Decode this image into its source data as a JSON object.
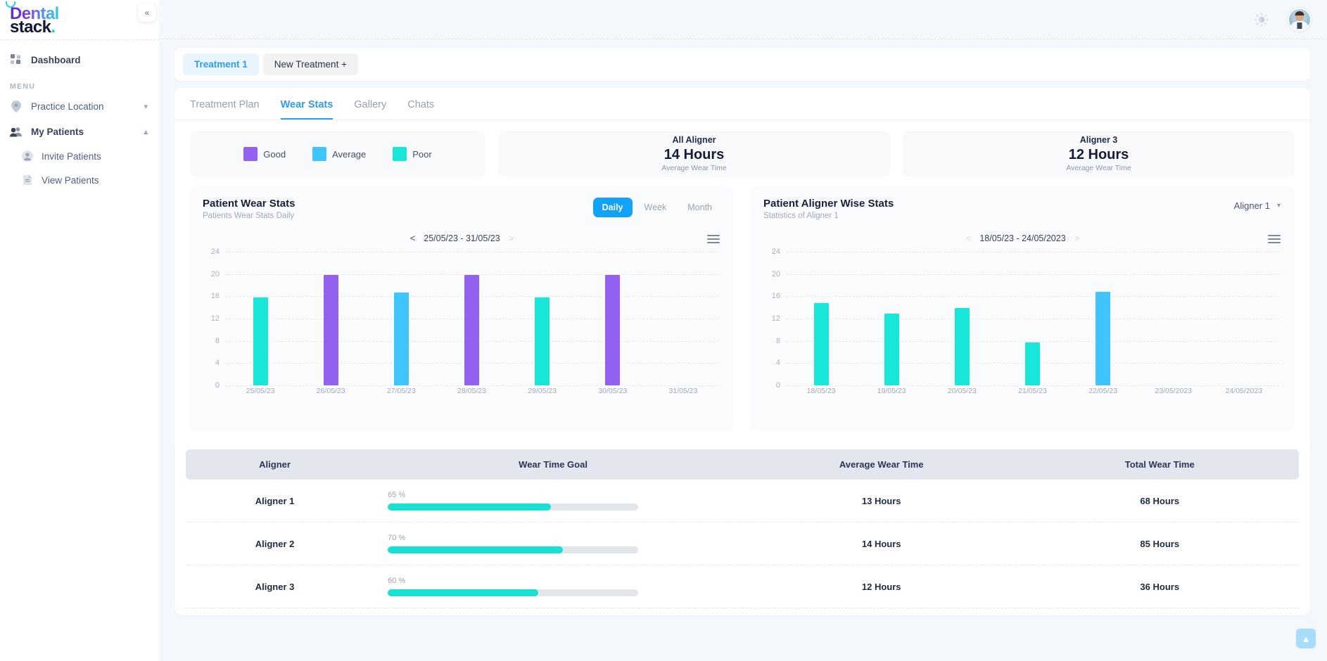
{
  "brand": {
    "name_top": "Dental",
    "name_bottom": "stack",
    "dot": "."
  },
  "sidebar": {
    "collapse_icon": "chevron-double-left-icon",
    "dashboard": {
      "label": "Dashboard",
      "icon": "grid-icon"
    },
    "menu_heading": "MENU",
    "items": [
      {
        "label": "Practice Location",
        "icon": "location-pin-icon",
        "caret": "chevron-down-icon",
        "expanded": false
      },
      {
        "label": "My Patients",
        "icon": "people-icon",
        "caret": "chevron-up-icon",
        "expanded": true
      }
    ],
    "sub_items": [
      {
        "label": "Invite Patients",
        "icon": "user-circle-icon"
      },
      {
        "label": "View Patients",
        "icon": "document-icon"
      }
    ]
  },
  "topbar": {
    "theme_icon": "sun-moon-toggle-icon",
    "avatar": "doctor-avatar"
  },
  "treatments": {
    "tabs": [
      {
        "label": "Treatment 1",
        "active": true
      },
      {
        "label": "New Treatment +",
        "active": false
      }
    ]
  },
  "subtabs": [
    {
      "label": "Treatment Plan",
      "active": false
    },
    {
      "label": "Wear Stats",
      "active": true
    },
    {
      "label": "Gallery",
      "active": false
    },
    {
      "label": "Chats",
      "active": false
    }
  ],
  "legend": [
    {
      "label": "Good",
      "color": "#9361f0"
    },
    {
      "label": "Average",
      "color": "#3fc4fb"
    },
    {
      "label": "Poor",
      "color": "#18e6d8"
    }
  ],
  "stat_cards": [
    {
      "title": "All Aligner",
      "value": "14 Hours",
      "subtitle": "Average Wear Time"
    },
    {
      "title": "Aligner 3",
      "value": "12 Hours",
      "subtitle": "Average Wear Time"
    }
  ],
  "left_chart_panel": {
    "title": "Patient Wear Stats",
    "subtitle": "Patients Wear Stats Daily",
    "segments": [
      {
        "label": "Daily",
        "active": true
      },
      {
        "label": "Week",
        "active": false
      },
      {
        "label": "Month",
        "active": false
      }
    ],
    "range": "25/05/23 - 31/05/23",
    "prev_arrow": "<",
    "next_arrow": ">",
    "menu_icon": "hamburger-menu-icon"
  },
  "right_chart_panel": {
    "title": "Patient Aligner Wise Stats",
    "subtitle": "Statistics of Aligner 1",
    "selected_aligner": "Aligner 1",
    "select_caret": "chevron-down-icon",
    "range": "18/05/23 - 24/05/2023",
    "prev_arrow": "<",
    "next_arrow": ">",
    "menu_icon": "hamburger-menu-icon"
  },
  "chart_data": [
    {
      "type": "bar",
      "id": "patient-wear-stats",
      "title": "Patient Wear Stats",
      "subtitle": "Patients Wear Stats Daily",
      "range_label": "25/05/23 - 31/05/23",
      "categories": [
        "25/05/23",
        "26/05/23",
        "27/05/23",
        "28/05/23",
        "29/05/23",
        "30/05/23",
        "31/05/23"
      ],
      "values": [
        15.8,
        19.8,
        16.7,
        19.8,
        15.8,
        19.8,
        null
      ],
      "bar_colors": [
        "#18e6d8",
        "#9361f0",
        "#3fc4fb",
        "#9361f0",
        "#18e6d8",
        "#9361f0",
        null
      ],
      "bar_categories": [
        "Poor",
        "Good",
        "Average",
        "Good",
        "Poor",
        "Good",
        null
      ],
      "xlabel": "",
      "ylabel": "",
      "ylim": [
        0,
        24
      ],
      "yticks": [
        0,
        4,
        8,
        12,
        16,
        20,
        24
      ],
      "grid": true,
      "legend": [
        "Good",
        "Average",
        "Poor"
      ],
      "legend_position": "top-left-external"
    },
    {
      "type": "bar",
      "id": "patient-aligner-wise-stats",
      "title": "Patient Aligner Wise Stats",
      "subtitle": "Statistics of Aligner 1",
      "range_label": "18/05/23 - 24/05/2023",
      "categories": [
        "18/05/23",
        "19/05/23",
        "20/05/23",
        "21/05/23",
        "22/05/23",
        "23/05/2023",
        "24/05/2023"
      ],
      "values": [
        14.8,
        12.9,
        13.9,
        7.7,
        16.8,
        null,
        null
      ],
      "bar_colors": [
        "#18e6d8",
        "#18e6d8",
        "#18e6d8",
        "#18e6d8",
        "#3fc4fb",
        null,
        null
      ],
      "bar_categories": [
        "Poor",
        "Poor",
        "Poor",
        "Poor",
        "Average",
        null,
        null
      ],
      "xlabel": "",
      "ylabel": "",
      "ylim": [
        0,
        24
      ],
      "yticks": [
        0,
        4,
        8,
        12,
        16,
        20,
        24
      ],
      "grid": true,
      "legend": [
        "Good",
        "Average",
        "Poor"
      ],
      "legend_position": "top-left-external"
    }
  ],
  "table": {
    "columns": [
      "Aligner",
      "Wear Time Goal",
      "Average Wear Time",
      "Total Wear Time"
    ],
    "rows": [
      {
        "aligner": "Aligner 1",
        "goal_pct": "65 %",
        "goal_value": 65,
        "average_wear_time": "13 Hours",
        "total_wear_time": "68 Hours"
      },
      {
        "aligner": "Aligner 2",
        "goal_pct": "70 %",
        "goal_value": 70,
        "average_wear_time": "14 Hours",
        "total_wear_time": "85 Hours"
      },
      {
        "aligner": "Aligner 3",
        "goal_pct": "60 %",
        "goal_value": 60,
        "average_wear_time": "12 Hours",
        "total_wear_time": "36 Hours"
      }
    ]
  },
  "scroll_top": {
    "icon": "chevron-up-icon"
  },
  "colors": {
    "accent_blue": "#12a2f8",
    "good": "#9361f0",
    "average": "#3fc4fb",
    "poor": "#18e6d8",
    "progress": "#18e0d3",
    "page_bg": "#f4f7fb"
  }
}
